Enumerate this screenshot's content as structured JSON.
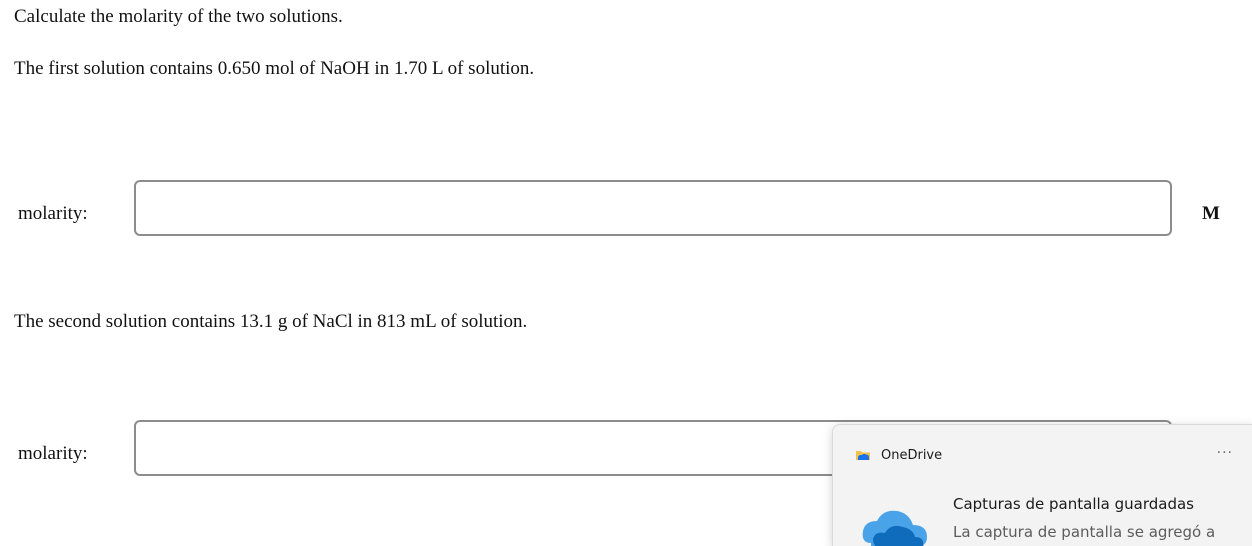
{
  "question": {
    "prompt": "Calculate the molarity of the two solutions.",
    "part1": {
      "text": "The first solution contains 0.650 mol of NaOH in 1.70 L of solution.",
      "label": "molarity:",
      "value": "",
      "unit": "M"
    },
    "part2": {
      "text": "The second solution contains 13.1 g of NaCl in 813 mL of solution.",
      "label": "molarity:",
      "value": ""
    }
  },
  "notification": {
    "app_name": "OneDrive",
    "app_icon": "onedrive-folder-icon",
    "more_label": "···",
    "title": "Capturas de pantalla guardadas",
    "body": "La captura de pantalla se agregó a",
    "image_icon": "onedrive-cloud-icon",
    "colors": {
      "background": "#f3f3f3",
      "cloud_dark": "#0f6cbd",
      "cloud_light": "#4aa3e8"
    }
  }
}
